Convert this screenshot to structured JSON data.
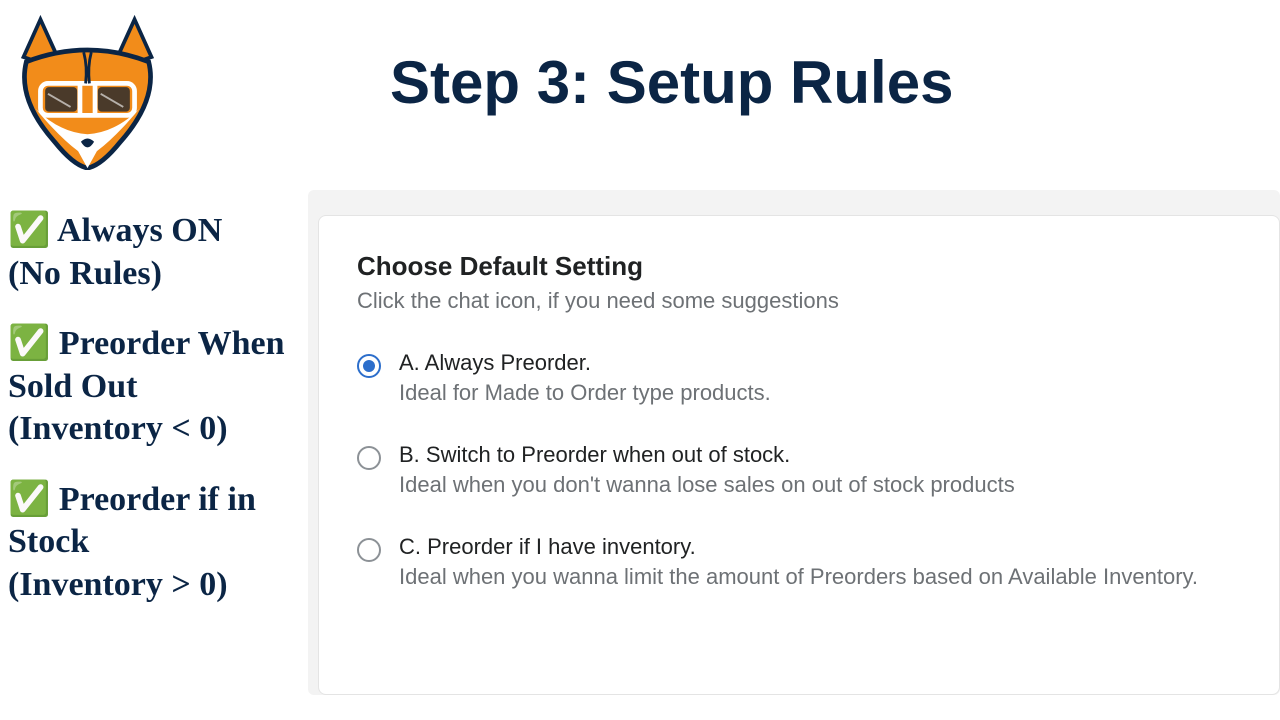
{
  "title": "Step 3: Setup Rules",
  "left_items": [
    {
      "line1": "✅ Always ON",
      "line2": "(No Rules)"
    },
    {
      "line1": "✅ Preorder When Sold Out",
      "line2": "(Inventory < 0)"
    },
    {
      "line1": "✅ Preorder if in Stock",
      "line2": "(Inventory > 0)"
    }
  ],
  "card": {
    "heading": "Choose Default Setting",
    "subtext": "Click the chat icon, if you need some suggestions",
    "options": [
      {
        "label": "A. Always Preorder.",
        "hint": "Ideal for Made to Order type products.",
        "selected": true
      },
      {
        "label": "B. Switch to Preorder when out of stock.",
        "hint": "Ideal when you don't wanna lose sales on out of stock products",
        "selected": false
      },
      {
        "label": "C. Preorder if I have inventory.",
        "hint": "Ideal when you wanna limit the amount of Preorders based on Available Inventory.",
        "selected": false
      }
    ]
  }
}
